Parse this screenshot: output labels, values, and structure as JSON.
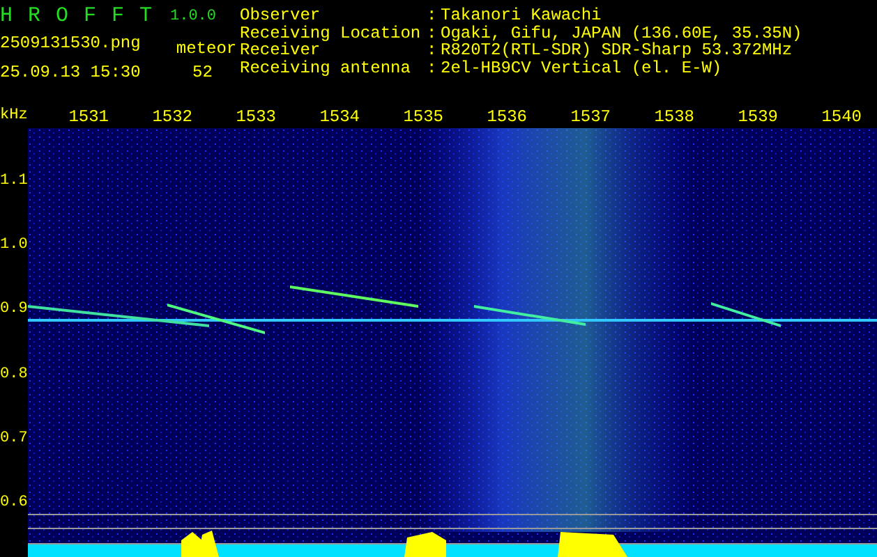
{
  "app": {
    "name": "H R O F F T",
    "version": "1.0.0"
  },
  "file": {
    "filename": "2509131530.png",
    "timestamp": "25.09.13 15:30"
  },
  "count": {
    "label": "meteor",
    "value": "52"
  },
  "info": [
    {
      "label": "Observer",
      "value": "Takanori Kawachi"
    },
    {
      "label": "Receiving Location",
      "value": "Ogaki, Gifu, JAPAN (136.60E, 35.35N)"
    },
    {
      "label": "Receiver",
      "value": "R820T2(RTL-SDR) SDR-Sharp 53.372MHz"
    },
    {
      "label": "Receiving antenna",
      "value": "2el-HB9CV Vertical (el. E-W)"
    }
  ],
  "separator": ":",
  "y_axis": {
    "unit": "kHz",
    "ticks": [
      "1.1",
      "1.0",
      "0.9",
      "0.8",
      "0.7",
      "0.6"
    ]
  },
  "x_axis": {
    "ticks": [
      "1531",
      "1532",
      "1533",
      "1534",
      "1535",
      "1536",
      "1537",
      "1538",
      "1539",
      "1540"
    ]
  }
}
